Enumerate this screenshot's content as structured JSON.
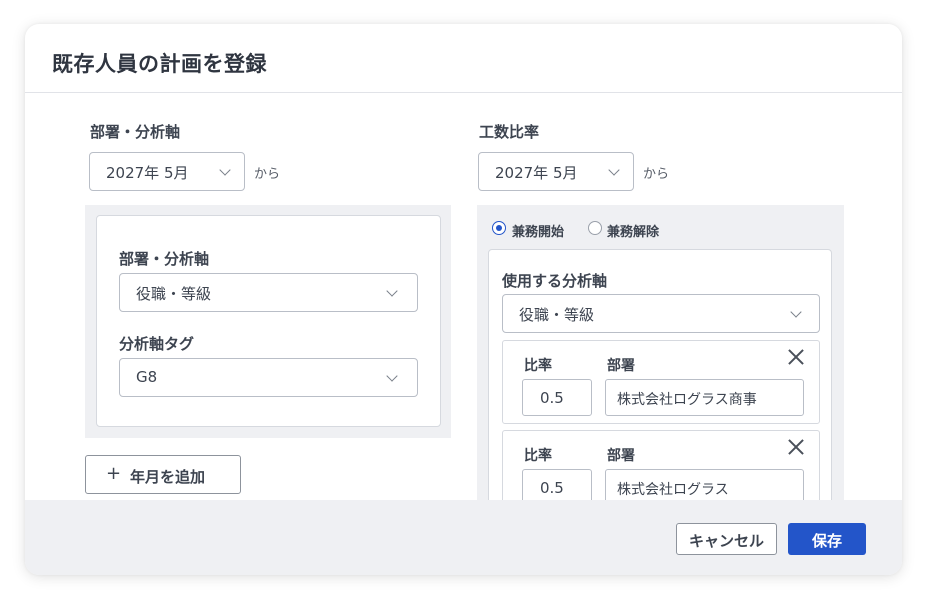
{
  "dialog": {
    "title": "既存人員の計画を登録"
  },
  "left": {
    "heading": "部署・分析軸",
    "date_select": {
      "value": "2027年 5月"
    },
    "from_suffix": "から",
    "card": {
      "axis_label": "部署・分析軸",
      "axis_select": {
        "value": "役職・等級"
      },
      "tag_label": "分析軸タグ",
      "tag_select": {
        "value": "G8"
      }
    },
    "add_button_label": "年月を追加"
  },
  "right": {
    "heading": "工数比率",
    "date_select": {
      "value": "2027年 5月"
    },
    "from_suffix": "から",
    "radios": [
      {
        "label": "兼務開始",
        "selected": true
      },
      {
        "label": "兼務解除",
        "selected": false
      }
    ],
    "card": {
      "axis_label": "使用する分析軸",
      "axis_select": {
        "value": "役職・等級"
      },
      "rows": [
        {
          "ratio_label": "比率",
          "ratio_value": "0.5",
          "dept_label": "部署",
          "dept_value": "株式会社ログラス商事"
        },
        {
          "ratio_label": "比率",
          "ratio_value": "0.5",
          "dept_label": "部署",
          "dept_value": "株式会社ログラス"
        }
      ]
    }
  },
  "footer": {
    "cancel_label": "キャンセル",
    "save_label": "保存"
  },
  "colors": {
    "primary": "#2355c9",
    "panel": "#eff0f3",
    "border": "#b9bec7"
  }
}
